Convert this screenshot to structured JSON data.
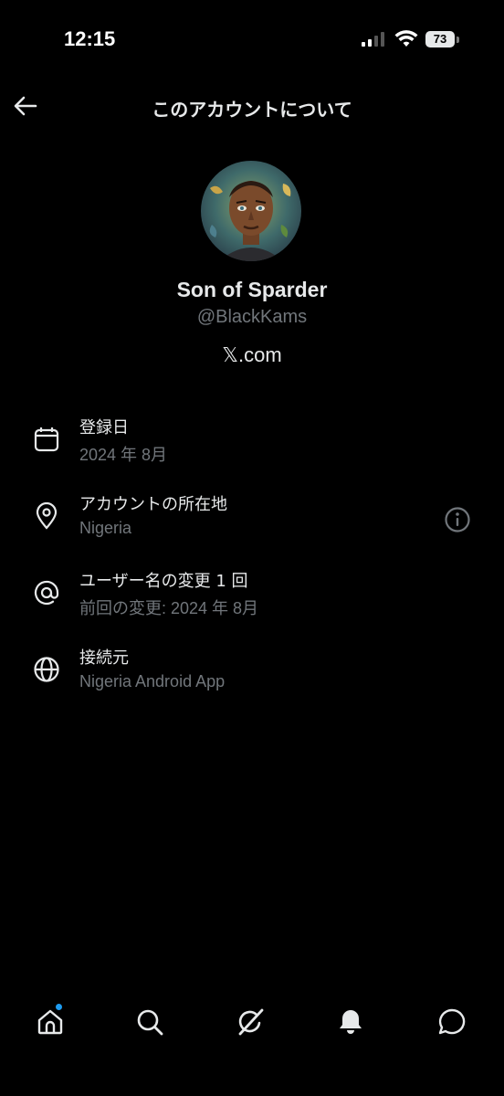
{
  "status_bar": {
    "time": "12:15",
    "battery": "73"
  },
  "header": {
    "title": "このアカウントについて"
  },
  "profile": {
    "display_name": "Son of Sparder",
    "handle": "@BlackKams",
    "site": "𝕏.com"
  },
  "rows": [
    {
      "icon": "calendar-icon",
      "label": "登録日",
      "value": "2024 年 8月"
    },
    {
      "icon": "location-pin-icon",
      "label": "アカウントの所在地",
      "value": "Nigeria"
    },
    {
      "icon": "at-sign-icon",
      "label": "ユーザー名の変更 1 回",
      "value": "前回の変更: 2024 年 8月"
    },
    {
      "icon": "globe-icon",
      "label": "接続元",
      "value": "Nigeria Android App"
    }
  ],
  "bottom_nav": [
    "home-icon",
    "search-icon",
    "grok-icon",
    "notifications-icon",
    "messages-icon"
  ],
  "colors": {
    "background": "#000000",
    "text": "#e7e9ea",
    "secondary": "#71767b",
    "accent": "#1d9bf0"
  }
}
